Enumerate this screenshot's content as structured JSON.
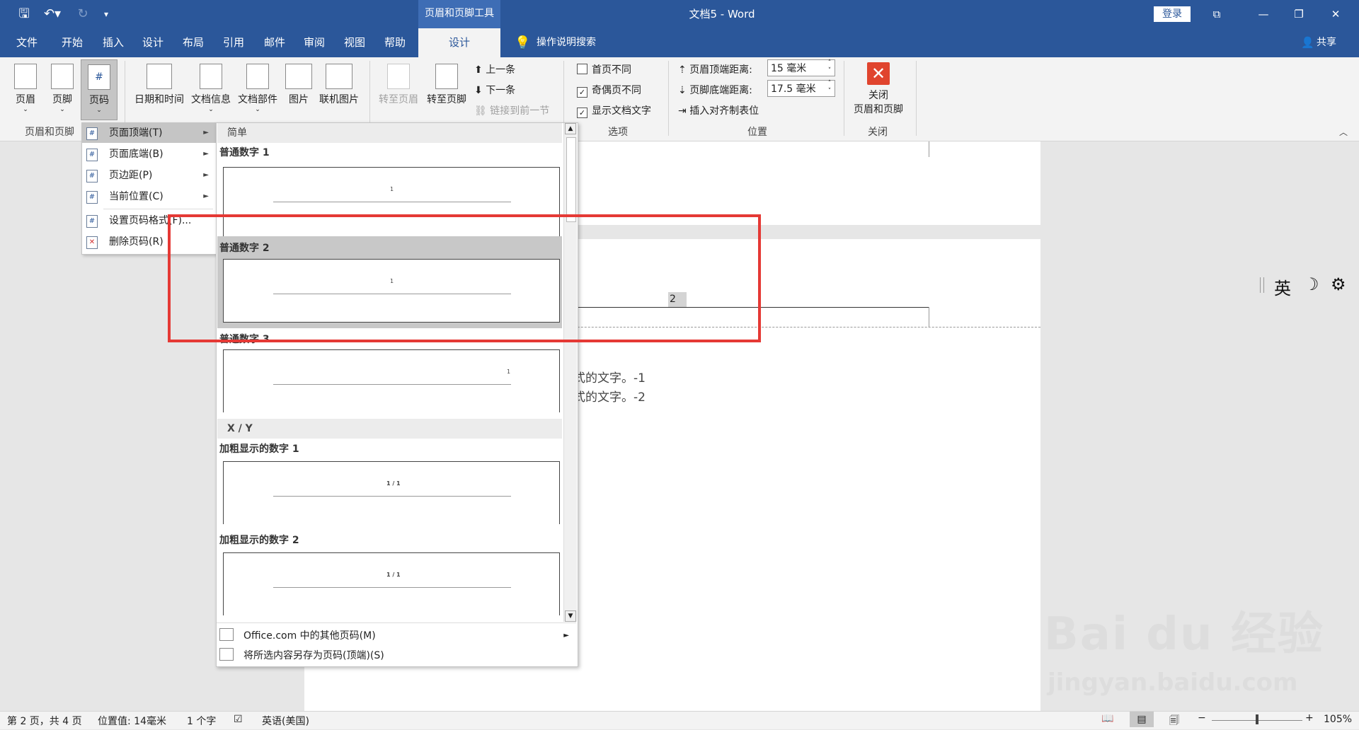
{
  "window": {
    "title": "文档5 - Word",
    "context_tool": "页眉和页脚工具",
    "login": "登录"
  },
  "tabs": [
    "文件",
    "开始",
    "插入",
    "设计",
    "布局",
    "引用",
    "邮件",
    "审阅",
    "视图",
    "帮助",
    "设计"
  ],
  "search_label": "操作说明搜索",
  "share_label": "共享",
  "ribbon": {
    "header_btn": "页眉",
    "footer_btn": "页脚",
    "pagenum_btn": "页码",
    "group_hf": "页眉和页脚",
    "datetime_btn": "日期和时间",
    "docinfo_btn": "文档信息",
    "docparts_btn": "文档部件",
    "picture_btn": "图片",
    "online_picture_btn": "联机图片",
    "goto_header_btn": "转至页眉",
    "goto_footer_btn": "转至页脚",
    "prev_btn": "上一条",
    "next_btn": "下一条",
    "link_prev_btn": "链接到前一节",
    "opt_first": "首页不同",
    "opt_oddeven": "奇偶页不同",
    "opt_showtext": "显示文档文字",
    "group_options": "选项",
    "top_dist_label": "页眉顶端距离:",
    "top_dist_value": "15 毫米",
    "bottom_dist_label": "页脚底端距离:",
    "bottom_dist_value": "17.5 毫米",
    "insert_tab_label": "插入对齐制表位",
    "group_position": "位置",
    "close_btn_line1": "关闭",
    "close_btn_line2": "页眉和页脚",
    "group_close": "关闭"
  },
  "submenu": {
    "items": [
      {
        "label": "页面顶端(T)",
        "arrow": "►"
      },
      {
        "label": "页面底端(B)",
        "arrow": "►"
      },
      {
        "label": "页边距(P)",
        "arrow": "►"
      },
      {
        "label": "当前位置(C)",
        "arrow": "►"
      },
      {
        "label": "设置页码格式(F)..."
      },
      {
        "label": "删除页码(R)"
      }
    ]
  },
  "gallery": {
    "section1": "简单",
    "section2": "X / Y",
    "items": [
      {
        "label": "普通数字 1",
        "num": "1"
      },
      {
        "label": "普通数字 2",
        "num": "1"
      },
      {
        "label": "普通数字 3",
        "num": "1"
      },
      {
        "label": "加粗显示的数字 1",
        "num": "1 / 1"
      },
      {
        "label": "加粗显示的数字 2",
        "num": "1 / 1"
      }
    ],
    "footer1": "Office.com 中的其他页码(M)",
    "footer2": "将所选内容另存为页码(顶端)(S)"
  },
  "document": {
    "page_number": "2",
    "line1": "式的文字。-1",
    "line2": "式的文字。-2"
  },
  "ime": {
    "lang": "英",
    "moon": "☽",
    "gear": "⚙"
  },
  "statusbar": {
    "page": "第 2 页，共 4 页",
    "position": "位置值: 14毫米",
    "words": "1 个字",
    "language": "英语(美国)",
    "zoom": "105%"
  },
  "watermark": {
    "brand": "Bai du 经验",
    "url": "jingyan.baidu.com"
  },
  "colors": {
    "word_blue": "#2b579a",
    "highlight_red": "#e53935"
  }
}
